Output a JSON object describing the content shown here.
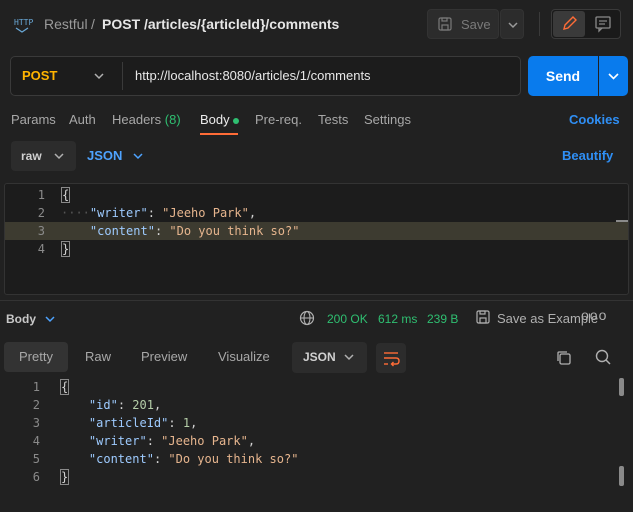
{
  "header": {
    "breadcrumb_parent": "Restful",
    "breadcrumb_sep": "/",
    "title": "POST /articles/{articleId}/comments",
    "save_label": "Save"
  },
  "request": {
    "method": "POST",
    "url": "http://localhost:8080/articles/1/comments",
    "send_label": "Send"
  },
  "tabs": {
    "params": "Params",
    "auth": "Auth",
    "headers": "Headers",
    "headers_count": "(8)",
    "body": "Body",
    "prereq": "Pre-req.",
    "tests": "Tests",
    "settings": "Settings",
    "cookies": "Cookies"
  },
  "body_bar": {
    "mode": "raw",
    "format": "JSON",
    "beautify": "Beautify"
  },
  "request_body": {
    "line_numbers": [
      "1",
      "2",
      "3",
      "4"
    ],
    "open": "{",
    "writer_key": "\"writer\"",
    "writer_value": "\"Jeeho Park\"",
    "content_key": "\"content\"",
    "content_value": "\"Do you think so?\"",
    "close": "}"
  },
  "response_bar": {
    "label": "Body",
    "status": "200 OK",
    "time": "612 ms",
    "size": "239 B",
    "save_example": "Save as Example",
    "more": "ooo"
  },
  "response_tabs": {
    "pretty": "Pretty",
    "raw": "Raw",
    "preview": "Preview",
    "visualize": "Visualize",
    "format": "JSON"
  },
  "response_body": {
    "line_numbers": [
      "1",
      "2",
      "3",
      "4",
      "5",
      "6"
    ],
    "open": "{",
    "id_key": "\"id\"",
    "id_value": "201",
    "article_key": "\"articleId\"",
    "article_value": "1",
    "writer_key": "\"writer\"",
    "writer_value": "\"Jeeho Park\"",
    "content_key": "\"content\"",
    "content_value": "\"Do you think so?\"",
    "close": "}"
  },
  "colors": {
    "accent_blue": "#097bed",
    "method_orange": "#ffb400",
    "status_green": "#2fbf71",
    "tab_underline": "#ff6c37"
  }
}
